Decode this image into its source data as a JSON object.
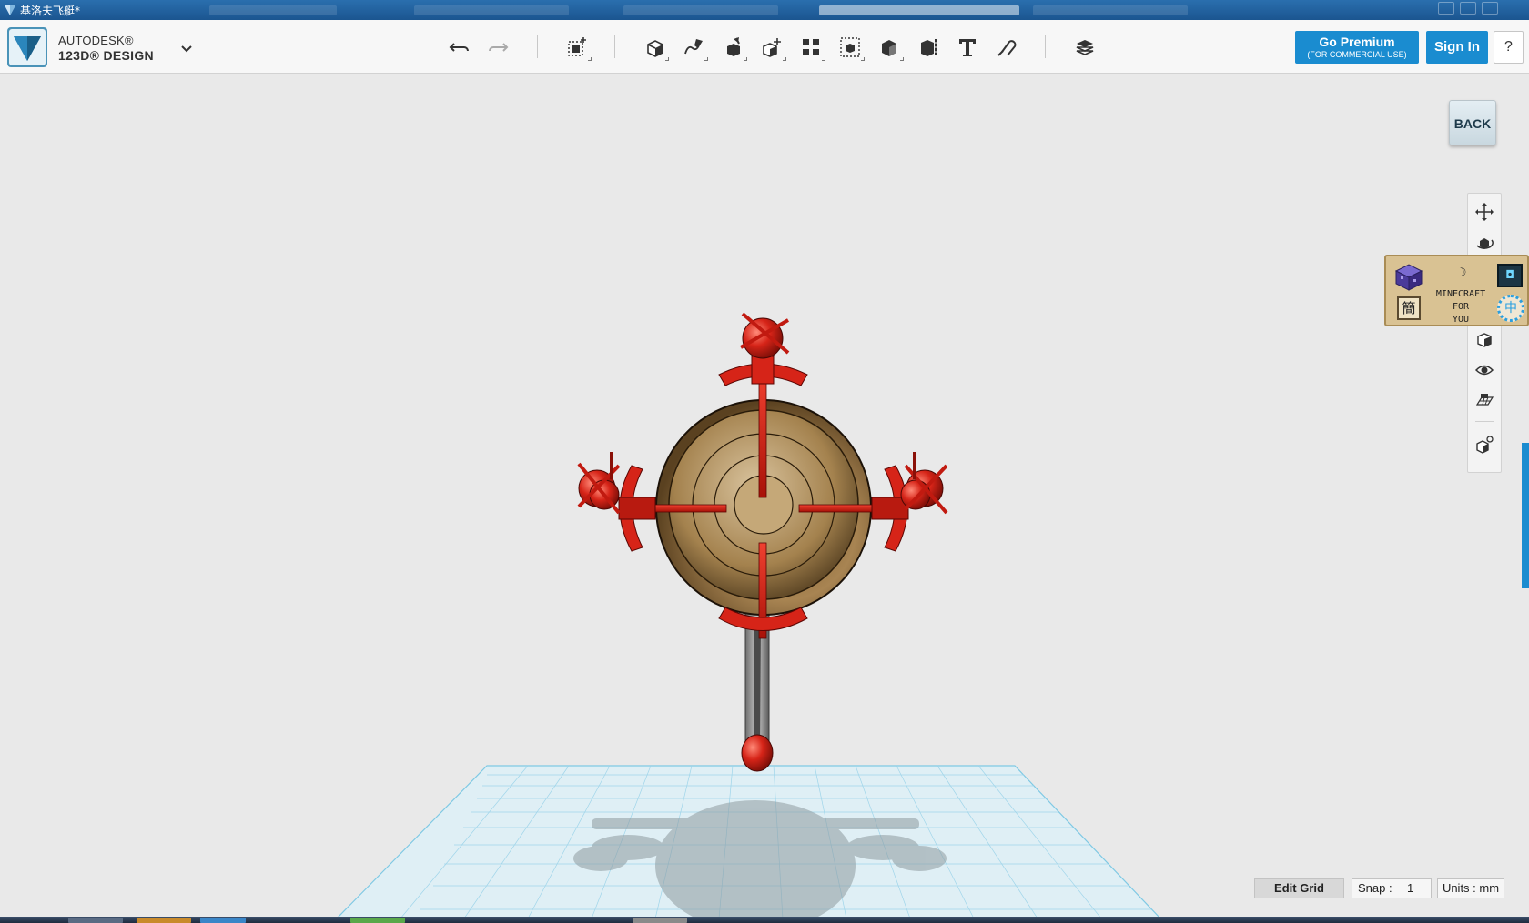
{
  "window": {
    "title": "基洛夫飞艇*",
    "accent": "#1b5590"
  },
  "brand": {
    "company": "AUTODESK®",
    "product": "123D® DESIGN",
    "menu_icon": "chevron-down-icon"
  },
  "toolbar": {
    "tools": [
      {
        "name": "undo",
        "icon": "undo-icon"
      },
      {
        "name": "redo",
        "icon": "redo-icon"
      },
      {
        "name": "transform",
        "icon": "transform-box-icon"
      },
      {
        "name": "primitives",
        "icon": "primitive-cube-icon"
      },
      {
        "name": "sketch",
        "icon": "sketch-pencil-icon"
      },
      {
        "name": "construct",
        "icon": "construct-extrude-icon"
      },
      {
        "name": "modify",
        "icon": "modify-icon"
      },
      {
        "name": "pattern",
        "icon": "pattern-icon"
      },
      {
        "name": "grouping",
        "icon": "grouping-icon"
      },
      {
        "name": "combine",
        "icon": "combine-icon"
      },
      {
        "name": "measure",
        "icon": "measure-icon"
      },
      {
        "name": "text",
        "icon": "text-icon"
      },
      {
        "name": "snap",
        "icon": "snap-magnet-icon"
      },
      {
        "name": "material",
        "icon": "material-layers-icon"
      }
    ],
    "premium": {
      "label": "Go Premium",
      "sublabel": "(FOR COMMERCIAL USE)"
    },
    "signin_label": "Sign In",
    "help_label": "?",
    "button_color": "#1a8cd0"
  },
  "viewport": {
    "back_label": "BACK",
    "model_colors": {
      "red": "#d62418",
      "bronze": "#8a6a3c",
      "steel": "#8d8d8d",
      "grid": "#7fc9e4"
    }
  },
  "navbar": {
    "items": [
      {
        "name": "pan",
        "icon": "pan-arrows-icon"
      },
      {
        "name": "orbit",
        "icon": "orbit-icon"
      },
      {
        "name": "view-cube",
        "icon": "view-cube-icon"
      },
      {
        "name": "visibility",
        "icon": "eye-icon"
      },
      {
        "name": "grid-visibility",
        "icon": "grid-view-icon"
      },
      {
        "name": "materials",
        "icon": "material-cube-icon"
      }
    ]
  },
  "overlay": {
    "line1": "MINECRAFT",
    "line2": "FOR",
    "line3": "YOU",
    "jian": "簡",
    "zhong": "中",
    "moon": "☽",
    "dark_glyph": "◘"
  },
  "status": {
    "edit_grid": "Edit Grid",
    "snap_label": "Snap :",
    "snap_value": "1",
    "units": "Units : mm"
  }
}
